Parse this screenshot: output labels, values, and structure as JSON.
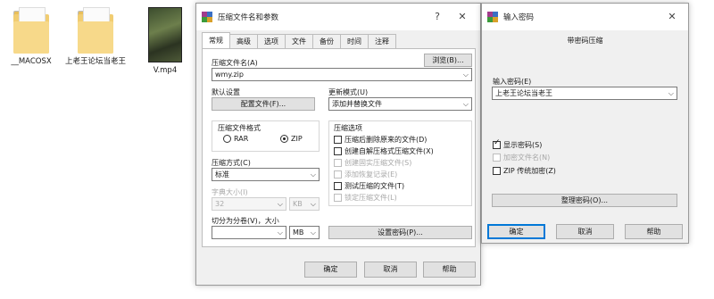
{
  "desktop": {
    "files": [
      {
        "name": "__MACOSX",
        "type": "folder"
      },
      {
        "name": "上老王论坛当老王",
        "type": "folder"
      },
      {
        "name": "V.mp4",
        "type": "video"
      }
    ]
  },
  "archive_dialog": {
    "title": "压缩文件名和参数",
    "help_glyph": "?",
    "close_glyph": "✕",
    "tabs": [
      "常规",
      "高级",
      "选项",
      "文件",
      "备份",
      "时间",
      "注释"
    ],
    "archive_name_label": "压缩文件名(A)",
    "archive_name_value": "wmy.zip",
    "browse_label": "浏览(B)...",
    "default_settings_label": "默认设置",
    "profiles_label": "配置文件(F)...",
    "update_mode_label": "更新模式(U)",
    "update_mode_value": "添加并替换文件",
    "format_group_label": "压缩文件格式",
    "format_rar": "RAR",
    "format_zip": "ZIP",
    "selected_format": "ZIP",
    "options_group_label": "压缩选项",
    "options": [
      {
        "label": "压缩后删除原来的文件(D)",
        "checked": false,
        "enabled": true
      },
      {
        "label": "创建自解压格式压缩文件(X)",
        "checked": false,
        "enabled": true
      },
      {
        "label": "创建固实压缩文件(S)",
        "checked": false,
        "enabled": false
      },
      {
        "label": "添加恢复记录(E)",
        "checked": false,
        "enabled": false
      },
      {
        "label": "测试压缩的文件(T)",
        "checked": false,
        "enabled": true
      },
      {
        "label": "锁定压缩文件(L)",
        "checked": false,
        "enabled": false
      }
    ],
    "method_label": "压缩方式(C)",
    "method_value": "标准",
    "dict_size_label": "字典大小(I)",
    "dict_size_value": "32",
    "dict_unit": "KB",
    "split_label": "切分为分卷(V)，大小",
    "split_value": "",
    "split_unit": "MB",
    "set_password_label": "设置密码(P)...",
    "ok_label": "确定",
    "cancel_label": "取消",
    "help_label": "帮助"
  },
  "password_dialog": {
    "title": "输入密码",
    "close_glyph": "✕",
    "heading": "带密码压缩",
    "enter_password_label": "输入密码(E)",
    "password_value": "上老王论坛当老王",
    "show_password_label": "显示密码(S)",
    "show_password_checked": true,
    "encrypt_names_label": "加密文件名(N)",
    "encrypt_names_enabled": false,
    "zip_legacy_label": "ZIP 传统加密(Z)",
    "zip_legacy_checked": false,
    "organize_label": "整理密码(O)...",
    "ok_label": "确定",
    "cancel_label": "取消",
    "help_label": "帮助"
  }
}
